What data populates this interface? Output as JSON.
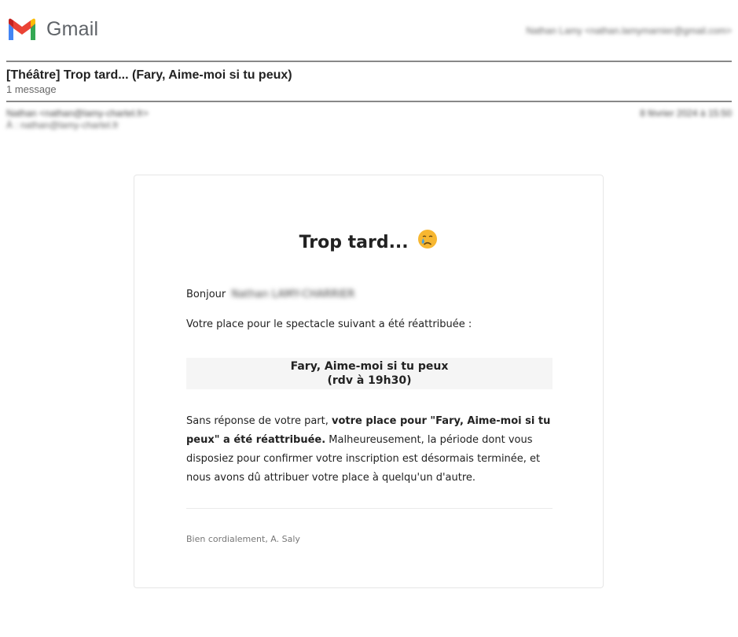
{
  "header": {
    "logo_text": "Gmail",
    "account": "Nathan Lamy <nathan.lamymarnier@gmail.com>"
  },
  "thread": {
    "subject": "[Théâtre] Trop tard... (Fary, Aime-moi si tu peux)",
    "message_count": "1 message"
  },
  "message": {
    "from": "Nathan <nathan@lamy-chartel.fr>",
    "to": "À : nathan@lamy-chartel.fr",
    "date": "8 février 2024 à 15:50"
  },
  "email": {
    "title": "Trop tard...",
    "title_emoji": "crying-face",
    "greeting": "Bonjour",
    "recipient_name": "Nathan LAMY-CHARRIER",
    "intro": "Votre place pour le spectacle suivant a été réattribuée :",
    "show_name": "Fary, Aime-moi si tu peux",
    "show_time": "(rdv à 19h30)",
    "body_prefix": "Sans réponse de votre part, ",
    "body_bold": "votre place pour \"Fary, Aime-moi si tu peux\" a été réattribuée.",
    "body_rest": " Malheureusement, la période dont vous disposiez pour confirmer votre inscription est désormais terminée, et nous avons dû attribuer votre place à quelqu'un d'autre.",
    "signature": "Bien cordialement, A. Saly"
  },
  "colors": {
    "gmail_red": "#ea4335",
    "gmail_blue": "#4285f4",
    "gmail_green": "#34a853",
    "gmail_yellow": "#fbbc04"
  }
}
